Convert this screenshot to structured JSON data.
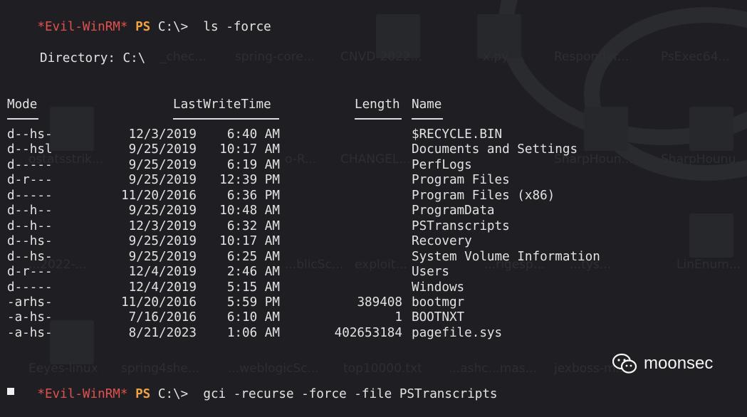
{
  "prompt1": {
    "host": "*Evil-WinRM*",
    "ps": "PS",
    "path": "C:\\>",
    "command": "ls -force"
  },
  "directory_label": "Directory: C:\\",
  "table": {
    "headers": {
      "mode": "Mode",
      "lastwrite": "LastWriteTime",
      "length": "Length",
      "name": "Name"
    },
    "rows": [
      {
        "mode": "d--hs-",
        "date": "12/3/2019",
        "time": "6:40 AM",
        "length": "",
        "name": "$RECYCLE.BIN"
      },
      {
        "mode": "d--hsl",
        "date": "9/25/2019",
        "time": "10:17 AM",
        "length": "",
        "name": "Documents and Settings"
      },
      {
        "mode": "d-----",
        "date": "9/25/2019",
        "time": "6:19 AM",
        "length": "",
        "name": "PerfLogs"
      },
      {
        "mode": "d-r---",
        "date": "9/25/2019",
        "time": "12:39 PM",
        "length": "",
        "name": "Program Files"
      },
      {
        "mode": "d-----",
        "date": "11/20/2016",
        "time": "6:36 PM",
        "length": "",
        "name": "Program Files (x86)"
      },
      {
        "mode": "d--h--",
        "date": "9/25/2019",
        "time": "10:48 AM",
        "length": "",
        "name": "ProgramData"
      },
      {
        "mode": "d--h--",
        "date": "12/3/2019",
        "time": "6:32 AM",
        "length": "",
        "name": "PSTranscripts"
      },
      {
        "mode": "d--hs-",
        "date": "9/25/2019",
        "time": "10:17 AM",
        "length": "",
        "name": "Recovery"
      },
      {
        "mode": "d--hs-",
        "date": "9/25/2019",
        "time": "6:25 AM",
        "length": "",
        "name": "System Volume Information"
      },
      {
        "mode": "d-r---",
        "date": "12/4/2019",
        "time": "2:46 AM",
        "length": "",
        "name": "Users"
      },
      {
        "mode": "d-----",
        "date": "12/4/2019",
        "time": "5:15 AM",
        "length": "",
        "name": "Windows"
      },
      {
        "mode": "-arhs-",
        "date": "11/20/2016",
        "time": "5:59 PM",
        "length": "389408",
        "name": "bootmgr"
      },
      {
        "mode": "-a-hs-",
        "date": "7/16/2016",
        "time": "6:10 AM",
        "length": "1",
        "name": "BOOTNXT"
      },
      {
        "mode": "-a-hs-",
        "date": "8/21/2023",
        "time": "1:06 AM",
        "length": "402653184",
        "name": "pagefile.sys"
      }
    ]
  },
  "prompt2": {
    "host": "*Evil-WinRM*",
    "ps": "PS",
    "path": "C:\\>",
    "command": "gci -recurse -force -file PSTranscripts"
  },
  "watermark": {
    "text": "moonsec",
    "icon": "wechat-icon"
  },
  "background_ghost_labels": [
    "_chec...",
    "spring-core...",
    "CNVD-2022...",
    "x.py",
    "Responder...",
    "PsExec64...",
    "ostatsstrik...",
    "o-R...",
    "CHANGEL...",
    "SharpHoun...",
    "SharpHounu...",
    "...2022-...",
    "...blicSc...",
    "exploit...",
    "...rigesp...",
    "...tys...",
    "LinEnum...",
    "Eeyes-linux",
    "spring4she...",
    "...weblogicSc...",
    "top10000.txt",
    "...ashc...mas...",
    "jexboss-m..."
  ],
  "colors": {
    "prompt_host": "#e0514e",
    "prompt_ps": "#f0a340",
    "text": "#e3e3e3",
    "background": "#1f1f23"
  }
}
